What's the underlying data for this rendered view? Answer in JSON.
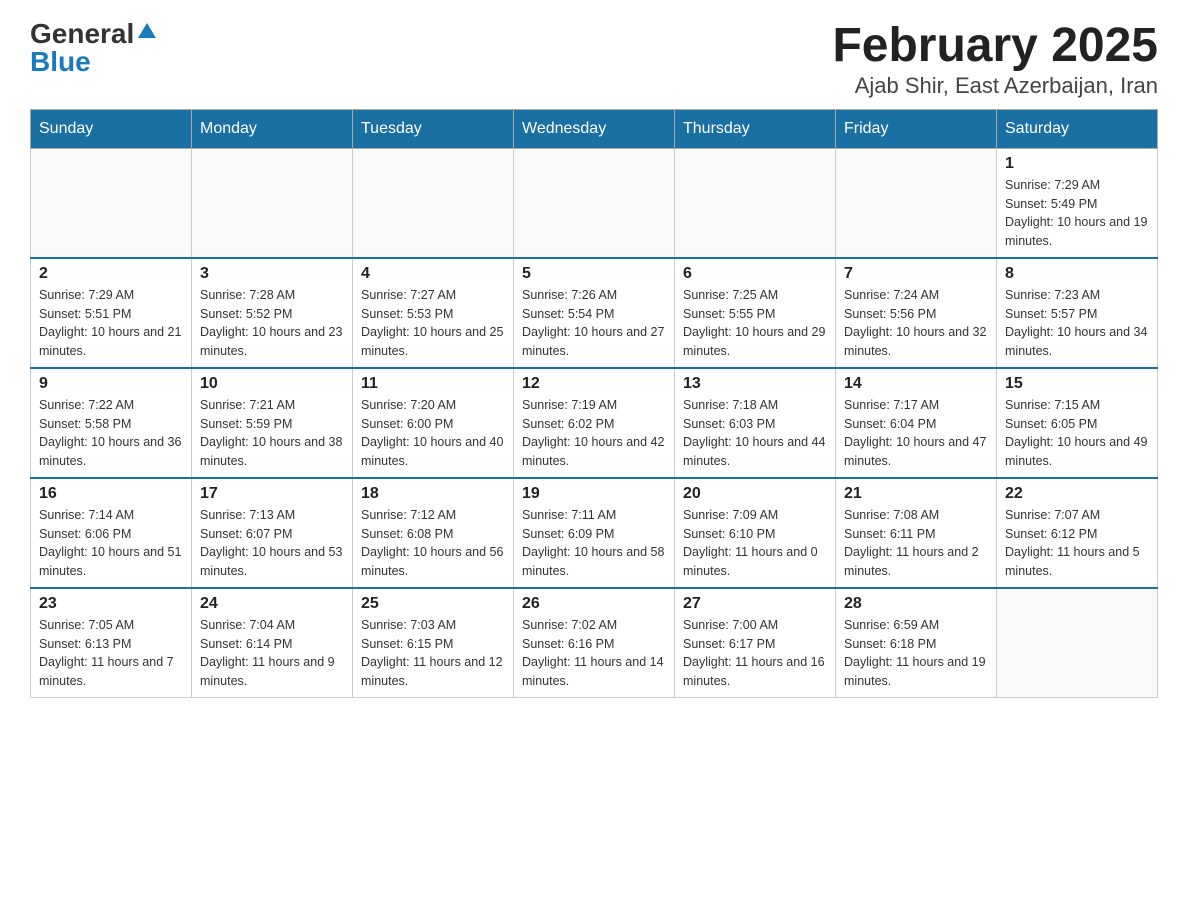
{
  "header": {
    "logo_general": "General",
    "logo_blue": "Blue",
    "title": "February 2025",
    "subtitle": "Ajab Shir, East Azerbaijan, Iran"
  },
  "weekdays": [
    "Sunday",
    "Monday",
    "Tuesday",
    "Wednesday",
    "Thursday",
    "Friday",
    "Saturday"
  ],
  "weeks": [
    [
      {
        "day": "",
        "sunrise": "",
        "sunset": "",
        "daylight": ""
      },
      {
        "day": "",
        "sunrise": "",
        "sunset": "",
        "daylight": ""
      },
      {
        "day": "",
        "sunrise": "",
        "sunset": "",
        "daylight": ""
      },
      {
        "day": "",
        "sunrise": "",
        "sunset": "",
        "daylight": ""
      },
      {
        "day": "",
        "sunrise": "",
        "sunset": "",
        "daylight": ""
      },
      {
        "day": "",
        "sunrise": "",
        "sunset": "",
        "daylight": ""
      },
      {
        "day": "1",
        "sunrise": "Sunrise: 7:29 AM",
        "sunset": "Sunset: 5:49 PM",
        "daylight": "Daylight: 10 hours and 19 minutes."
      }
    ],
    [
      {
        "day": "2",
        "sunrise": "Sunrise: 7:29 AM",
        "sunset": "Sunset: 5:51 PM",
        "daylight": "Daylight: 10 hours and 21 minutes."
      },
      {
        "day": "3",
        "sunrise": "Sunrise: 7:28 AM",
        "sunset": "Sunset: 5:52 PM",
        "daylight": "Daylight: 10 hours and 23 minutes."
      },
      {
        "day": "4",
        "sunrise": "Sunrise: 7:27 AM",
        "sunset": "Sunset: 5:53 PM",
        "daylight": "Daylight: 10 hours and 25 minutes."
      },
      {
        "day": "5",
        "sunrise": "Sunrise: 7:26 AM",
        "sunset": "Sunset: 5:54 PM",
        "daylight": "Daylight: 10 hours and 27 minutes."
      },
      {
        "day": "6",
        "sunrise": "Sunrise: 7:25 AM",
        "sunset": "Sunset: 5:55 PM",
        "daylight": "Daylight: 10 hours and 29 minutes."
      },
      {
        "day": "7",
        "sunrise": "Sunrise: 7:24 AM",
        "sunset": "Sunset: 5:56 PM",
        "daylight": "Daylight: 10 hours and 32 minutes."
      },
      {
        "day": "8",
        "sunrise": "Sunrise: 7:23 AM",
        "sunset": "Sunset: 5:57 PM",
        "daylight": "Daylight: 10 hours and 34 minutes."
      }
    ],
    [
      {
        "day": "9",
        "sunrise": "Sunrise: 7:22 AM",
        "sunset": "Sunset: 5:58 PM",
        "daylight": "Daylight: 10 hours and 36 minutes."
      },
      {
        "day": "10",
        "sunrise": "Sunrise: 7:21 AM",
        "sunset": "Sunset: 5:59 PM",
        "daylight": "Daylight: 10 hours and 38 minutes."
      },
      {
        "day": "11",
        "sunrise": "Sunrise: 7:20 AM",
        "sunset": "Sunset: 6:00 PM",
        "daylight": "Daylight: 10 hours and 40 minutes."
      },
      {
        "day": "12",
        "sunrise": "Sunrise: 7:19 AM",
        "sunset": "Sunset: 6:02 PM",
        "daylight": "Daylight: 10 hours and 42 minutes."
      },
      {
        "day": "13",
        "sunrise": "Sunrise: 7:18 AM",
        "sunset": "Sunset: 6:03 PM",
        "daylight": "Daylight: 10 hours and 44 minutes."
      },
      {
        "day": "14",
        "sunrise": "Sunrise: 7:17 AM",
        "sunset": "Sunset: 6:04 PM",
        "daylight": "Daylight: 10 hours and 47 minutes."
      },
      {
        "day": "15",
        "sunrise": "Sunrise: 7:15 AM",
        "sunset": "Sunset: 6:05 PM",
        "daylight": "Daylight: 10 hours and 49 minutes."
      }
    ],
    [
      {
        "day": "16",
        "sunrise": "Sunrise: 7:14 AM",
        "sunset": "Sunset: 6:06 PM",
        "daylight": "Daylight: 10 hours and 51 minutes."
      },
      {
        "day": "17",
        "sunrise": "Sunrise: 7:13 AM",
        "sunset": "Sunset: 6:07 PM",
        "daylight": "Daylight: 10 hours and 53 minutes."
      },
      {
        "day": "18",
        "sunrise": "Sunrise: 7:12 AM",
        "sunset": "Sunset: 6:08 PM",
        "daylight": "Daylight: 10 hours and 56 minutes."
      },
      {
        "day": "19",
        "sunrise": "Sunrise: 7:11 AM",
        "sunset": "Sunset: 6:09 PM",
        "daylight": "Daylight: 10 hours and 58 minutes."
      },
      {
        "day": "20",
        "sunrise": "Sunrise: 7:09 AM",
        "sunset": "Sunset: 6:10 PM",
        "daylight": "Daylight: 11 hours and 0 minutes."
      },
      {
        "day": "21",
        "sunrise": "Sunrise: 7:08 AM",
        "sunset": "Sunset: 6:11 PM",
        "daylight": "Daylight: 11 hours and 2 minutes."
      },
      {
        "day": "22",
        "sunrise": "Sunrise: 7:07 AM",
        "sunset": "Sunset: 6:12 PM",
        "daylight": "Daylight: 11 hours and 5 minutes."
      }
    ],
    [
      {
        "day": "23",
        "sunrise": "Sunrise: 7:05 AM",
        "sunset": "Sunset: 6:13 PM",
        "daylight": "Daylight: 11 hours and 7 minutes."
      },
      {
        "day": "24",
        "sunrise": "Sunrise: 7:04 AM",
        "sunset": "Sunset: 6:14 PM",
        "daylight": "Daylight: 11 hours and 9 minutes."
      },
      {
        "day": "25",
        "sunrise": "Sunrise: 7:03 AM",
        "sunset": "Sunset: 6:15 PM",
        "daylight": "Daylight: 11 hours and 12 minutes."
      },
      {
        "day": "26",
        "sunrise": "Sunrise: 7:02 AM",
        "sunset": "Sunset: 6:16 PM",
        "daylight": "Daylight: 11 hours and 14 minutes."
      },
      {
        "day": "27",
        "sunrise": "Sunrise: 7:00 AM",
        "sunset": "Sunset: 6:17 PM",
        "daylight": "Daylight: 11 hours and 16 minutes."
      },
      {
        "day": "28",
        "sunrise": "Sunrise: 6:59 AM",
        "sunset": "Sunset: 6:18 PM",
        "daylight": "Daylight: 11 hours and 19 minutes."
      },
      {
        "day": "",
        "sunrise": "",
        "sunset": "",
        "daylight": ""
      }
    ]
  ]
}
